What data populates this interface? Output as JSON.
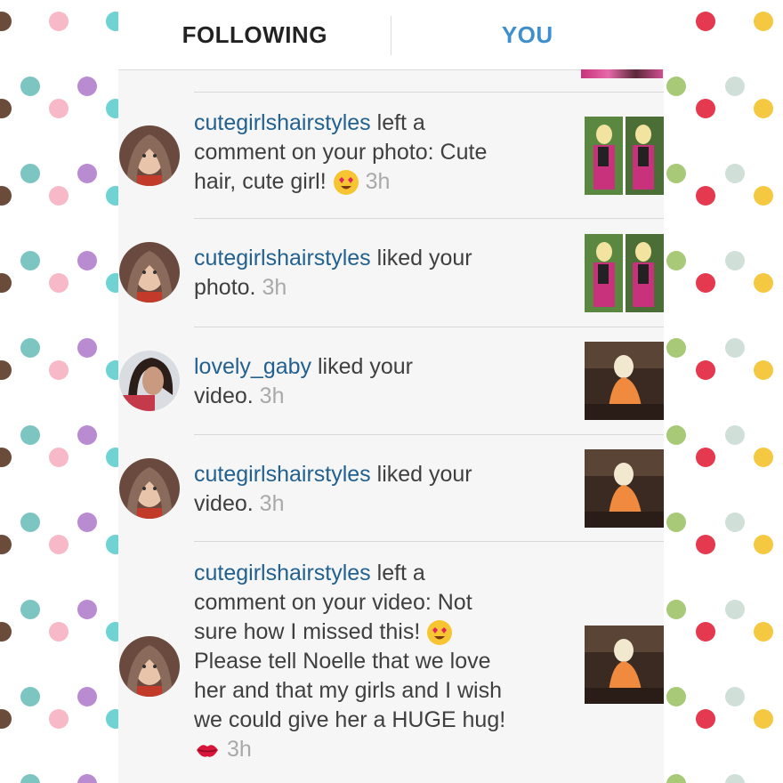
{
  "tabs": {
    "following": "FOLLOWING",
    "you": "YOU"
  },
  "colors": {
    "username": "#22618f",
    "active_tab": "#3d8fd0",
    "timestamp": "#a9a9a9",
    "dots": [
      "#6b4c3b",
      "#f7b9c8",
      "#6fd3d3",
      "#e53950",
      "#f5c842",
      "#7cc5c0",
      "#b98bd1",
      "#a8c977",
      "#d0e0d8"
    ]
  },
  "notifications": [
    {
      "user": "cutegirlshairstyles",
      "line1_rest": " left a",
      "line2": "comment on your photo: Cute",
      "line3": "hair, cute girl! ",
      "emoji": "heart-eyes",
      "time": "3h",
      "thumb": "photo"
    },
    {
      "user": "cutegirlshairstyles",
      "line1_rest": " liked your",
      "line2": "photo. ",
      "time": "3h",
      "thumb": "photo"
    },
    {
      "user": "lovely_gaby",
      "line1_rest": " liked your",
      "line2": "video. ",
      "time": "3h",
      "thumb": "video"
    },
    {
      "user": "cutegirlshairstyles",
      "line1_rest": " liked your",
      "line2": "video. ",
      "time": "3h",
      "thumb": "video"
    },
    {
      "user": "cutegirlshairstyles",
      "line1_rest": " left a",
      "line2": "comment on your video: Not",
      "line3": "sure how I missed this! ",
      "line4": "Please tell Noelle that we love",
      "line5": "her and that my girls and I wish",
      "line6": "we could give her a HUGE hug!",
      "emoji": "heart-eyes",
      "emoji2": "kiss-lips",
      "time": "3h",
      "thumb": "video"
    }
  ]
}
